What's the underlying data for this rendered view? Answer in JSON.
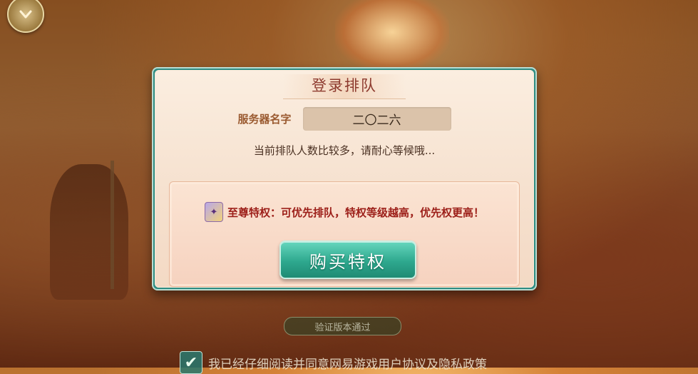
{
  "dialog": {
    "title": "登录排队",
    "server_label": "服务器名字",
    "server_name": "二〇二六",
    "queue_message": "当前排队人数比较多，请耐心等候哦..."
  },
  "privilege": {
    "icon": "privilege-card-icon",
    "text": "至尊特权：可优先排队，特权等级越高，优先权更高！",
    "buy_label": "购买特权"
  },
  "footer": {
    "verify_text": "验证版本通过",
    "agreement_text": "我已经仔细阅读并同意网易游戏用户协议及隐私政策"
  },
  "icons": {
    "back": "chevron-down-icon",
    "check": "checkmark-icon"
  }
}
